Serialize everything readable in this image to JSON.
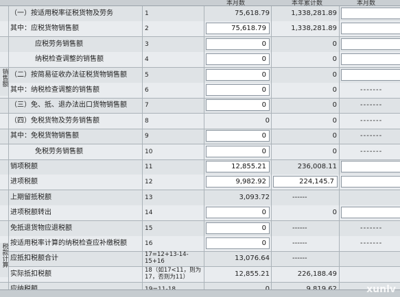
{
  "header": {
    "col_month": "本月数",
    "col_year": "本年累计数",
    "col_extra": "本月数"
  },
  "side_labels": {
    "sales": "销售额",
    "tax": "税款计算"
  },
  "rows": [
    {
      "item": "（一）按适用税率征税货物及劳务",
      "line": "1",
      "month": "75,618.79",
      "year": "1,338,281.89",
      "month_box": false,
      "year_box": false,
      "extra": "box",
      "indent": 0
    },
    {
      "item": "其中：应税货物销售额",
      "line": "2",
      "month": "75,618.79",
      "year": "1,338,281.89",
      "month_box": true,
      "year_box": false,
      "extra": "box",
      "indent": 0
    },
    {
      "item": "应税劳务销售额",
      "line": "3",
      "month": "0",
      "year": "0",
      "month_box": true,
      "year_box": false,
      "extra": "box",
      "indent": 2
    },
    {
      "item": "纳税检查调整的销售额",
      "line": "4",
      "month": "0",
      "year": "0",
      "month_box": true,
      "year_box": false,
      "extra": "box",
      "indent": 2
    },
    {
      "item": "（二）按简易征收办法征税货物销售额",
      "line": "5",
      "month": "0",
      "year": "0",
      "month_box": true,
      "year_box": false,
      "extra": "box",
      "indent": 0
    },
    {
      "item": "其中：纳税检查调整的销售额",
      "line": "6",
      "month": "0",
      "year": "0",
      "month_box": true,
      "year_box": false,
      "extra": "dash",
      "indent": 0
    },
    {
      "item": "（三）免、抵、退办法出口货物销售额",
      "line": "7",
      "month": "0",
      "year": "0",
      "month_box": true,
      "year_box": false,
      "extra": "dash",
      "indent": 0
    },
    {
      "item": "（四）免税货物及劳务销售额",
      "line": "8",
      "month": "0",
      "year": "0",
      "month_box": false,
      "year_box": false,
      "extra": "dash",
      "indent": 0
    },
    {
      "item": "其中：免税货物销售额",
      "line": "9",
      "month": "0",
      "year": "0",
      "month_box": true,
      "year_box": false,
      "extra": "dash",
      "indent": 0
    },
    {
      "item": "免税劳务销售额",
      "line": "10",
      "month": "0",
      "year": "0",
      "month_box": true,
      "year_box": false,
      "extra": "dash",
      "indent": 2
    },
    {
      "item": "销项税额",
      "line": "11",
      "month": "12,855.21",
      "year": "236,008.11",
      "month_box": true,
      "year_box": false,
      "extra": "box",
      "indent": 0
    },
    {
      "item": "进项税额",
      "line": "12",
      "month": "9,982.92",
      "year": "224,145.7",
      "month_box": true,
      "year_box": true,
      "extra": "box",
      "indent": 0
    },
    {
      "item": "上期留抵税额",
      "line": "13",
      "month": "3,093.72",
      "year": "------",
      "month_box": false,
      "year_box": false,
      "extra": "none",
      "indent": 0
    },
    {
      "item": "进项税额转出",
      "line": "14",
      "month": "0",
      "year": "0",
      "month_box": true,
      "year_box": false,
      "extra": "box",
      "indent": 0
    },
    {
      "item": "免抵退货物应退税额",
      "line": "15",
      "month": "0",
      "year": "------",
      "month_box": true,
      "year_box": false,
      "extra": "dash",
      "indent": 0
    },
    {
      "item": "按适用税率计算的纳税检查应补缴税额",
      "line": "16",
      "month": "0",
      "year": "------",
      "month_box": true,
      "year_box": false,
      "extra": "dash",
      "indent": 0
    },
    {
      "item": "应抵扣税额合计",
      "line": "17=12+13-14-15+16",
      "month": "13,076.64",
      "year": "------",
      "month_box": false,
      "year_box": false,
      "extra": "none",
      "indent": 0
    },
    {
      "item": "实际抵扣税额",
      "line": "18（如17<11，则为17，否则为11）",
      "month": "12,855.21",
      "year": "226,188.49",
      "month_box": false,
      "year_box": false,
      "extra": "none",
      "indent": 0
    },
    {
      "item": "应纳税额",
      "line": "19=11-18",
      "month": "0",
      "year": "9,819.62",
      "month_box": false,
      "year_box": false,
      "extra": "none",
      "indent": 0
    }
  ],
  "watermark": "xunlv"
}
